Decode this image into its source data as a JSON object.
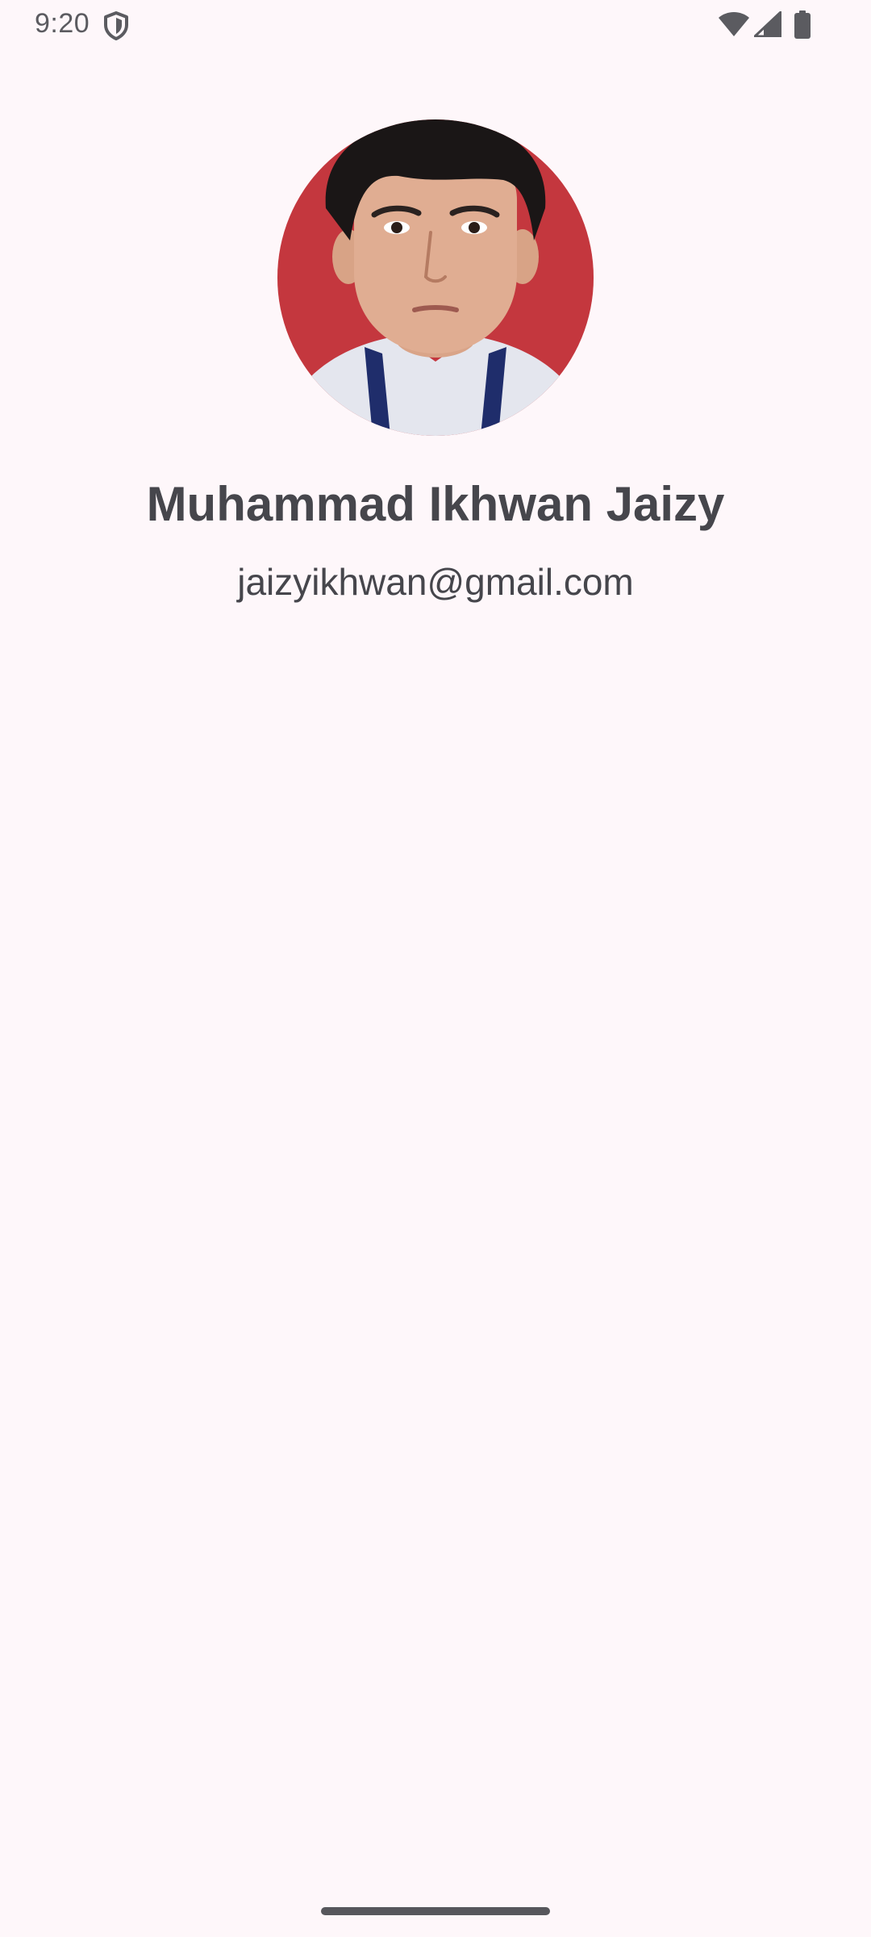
{
  "status_bar": {
    "time": "9:20",
    "icons": [
      "shield-icon",
      "wifi-icon",
      "cellular-signal-icon",
      "battery-icon"
    ]
  },
  "profile": {
    "avatar": "profile-photo",
    "name": "Muhammad Ikhwan Jaizy",
    "email": "jaizyikhwan@gmail.com"
  },
  "colors": {
    "background": "#FEF7FA",
    "text": "#46464C",
    "avatar_background": "#C83A3F"
  }
}
